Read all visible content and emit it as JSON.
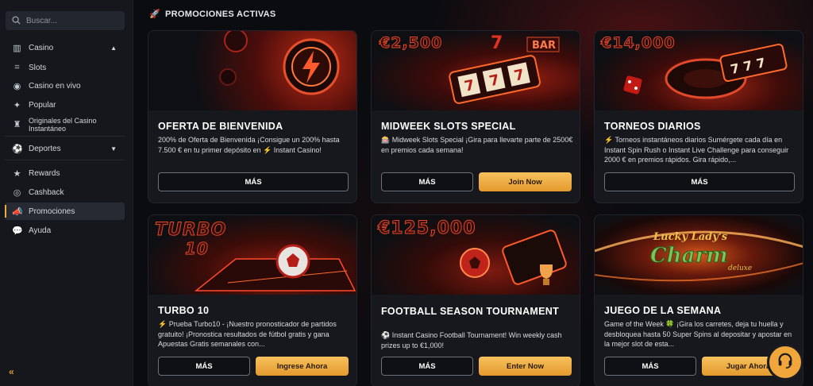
{
  "sidebar": {
    "search_placeholder": "Buscar...",
    "items": [
      {
        "label": "Casino",
        "icon": "casino-icon"
      },
      {
        "label": "Slots",
        "icon": "slots-icon"
      },
      {
        "label": "Casino en vivo",
        "icon": "live-casino-icon"
      },
      {
        "label": "Popular",
        "icon": "sparkle-icon"
      },
      {
        "label": "Originales del Casino Instantáneo",
        "icon": "originals-icon"
      },
      {
        "label": "Deportes",
        "icon": "sports-icon"
      },
      {
        "label": "Rewards",
        "icon": "star-icon"
      },
      {
        "label": "Cashback",
        "icon": "cashback-icon"
      },
      {
        "label": "Promociones",
        "icon": "megaphone-icon",
        "active": true
      },
      {
        "label": "Ayuda",
        "icon": "help-icon"
      }
    ],
    "collapse_glyph": "«"
  },
  "main": {
    "section_title": "PROMOCIONES ACTIVAS",
    "accent_color": "#f2a93b",
    "cards": [
      {
        "title": "OFERTA DE BIENVENIDA",
        "description": "200% de Oferta de Bienvenida ¡Consigue un 200% hasta 7.500 € en tu primer depósito en ⚡ Instant Casino!",
        "more_label": "MÁS"
      },
      {
        "banner_text": "€2,500",
        "title": "MIDWEEK SLOTS SPECIAL",
        "description": "🎰 Midweek Slots Special ¡Gira para llevarte parte de 2500€ en premios cada semana!",
        "more_label": "MÁS",
        "cta_label": "Join Now"
      },
      {
        "banner_text": "€14,000",
        "title": "TORNEOS DIARIOS",
        "description": "⚡ Torneos instantáneos diarios Sumérgete cada día en Instant Spin Rush o Instant Live Challenge para conseguir 2000 € en premios rápidos. Gira rápido,...",
        "more_label": "MÁS"
      },
      {
        "banner_text": "TURBO",
        "banner_text_2": "10",
        "title": "TURBO 10",
        "description": "⚡ Prueba Turbo10 - ¡Nuestro pronosticador de partidos gratuito! ¡Pronostica resultados de fútbol gratis y gana Apuestas Gratis semanales con...",
        "more_label": "MÁS",
        "cta_label": "Ingrese Ahora"
      },
      {
        "banner_text": "€125,000",
        "title": "FOOTBALL SEASON TOURNAMENT",
        "description": "⚽ Instant Casino Football Tournament! Win weekly cash prizes up to €1,000!",
        "more_label": "MÁS",
        "cta_label": "Enter Now"
      },
      {
        "banner_text": "Lucky Lady's",
        "banner_text_2": "Charm",
        "banner_text_3": "deluxe",
        "title": "JUEGO DE LA SEMANA",
        "description": "Game of the Week 🍀 ¡Gira los carretes, deja tu huella y desbloquea hasta 50 Super Spins al depositar y apostar en la mejor slot de esta...",
        "more_label": "MÁS",
        "cta_label": "Jugar Ahora"
      }
    ]
  },
  "support": {
    "icon": "headset-icon"
  }
}
